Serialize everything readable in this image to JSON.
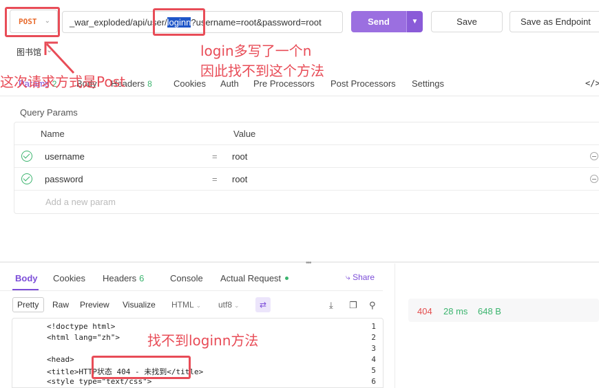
{
  "request": {
    "method": "POST",
    "url_before": "_war_exploded/api/user/",
    "url_selected": "loginn",
    "url_after": "?username=root&password=root",
    "send_label": "Send",
    "save_label": "Save",
    "save_endpoint_label": "Save as Endpoint"
  },
  "library_label": "图书馆",
  "request_tabs": [
    {
      "label": "Params",
      "count": "2"
    },
    {
      "label": "Body",
      "count": ""
    },
    {
      "label": "Headers",
      "count": "8"
    },
    {
      "label": "Cookies",
      "count": ""
    },
    {
      "label": "Auth",
      "count": ""
    },
    {
      "label": "Pre Processors",
      "count": ""
    },
    {
      "label": "Post Processors",
      "count": ""
    },
    {
      "label": "Settings",
      "count": ""
    }
  ],
  "code_tab_label": "</>",
  "query_params": {
    "title": "Query Params",
    "col_name": "Name",
    "col_value": "Value",
    "rows": [
      {
        "name": "username",
        "eq": "=",
        "value": "root"
      },
      {
        "name": "password",
        "eq": "=",
        "value": "root"
      }
    ],
    "add_placeholder": "Add a new param"
  },
  "response_tabs": [
    {
      "label": "Body",
      "count": ""
    },
    {
      "label": "Cookies",
      "count": ""
    },
    {
      "label": "Headers",
      "count": "6"
    },
    {
      "label": "Console",
      "count": ""
    },
    {
      "label": "Actual Request",
      "count": ""
    }
  ],
  "share_label": "Share",
  "view_modes": [
    "Pretty",
    "Raw",
    "Preview",
    "Visualize"
  ],
  "format_select": "HTML",
  "encoding_select": "utf8",
  "status": {
    "code": "404",
    "time": "28 ms",
    "size": "648 B"
  },
  "code_lines": [
    {
      "n": "1",
      "text": "<!doctype html>"
    },
    {
      "n": "2",
      "text": "<html lang=\"zh\">"
    },
    {
      "n": "3",
      "text": ""
    },
    {
      "n": "4",
      "text": "<head>"
    },
    {
      "n": "5",
      "text": "    <title>HTTP状态 404 - 未找到</title>"
    },
    {
      "n": "6",
      "text": "    <style type=\"text/css\">"
    }
  ],
  "annotations": {
    "method_note": "这次请求方式是Post",
    "url_note_line1": "login多写了一个n",
    "url_note_line2": "因此找不到这个方法",
    "response_note": "找不到loginn方法"
  },
  "colors": {
    "accent": "#7c4dd8",
    "send": "#9b6fe0",
    "annotation": "#e84c57",
    "success": "#3bb46e",
    "error": "#e44d4d"
  }
}
